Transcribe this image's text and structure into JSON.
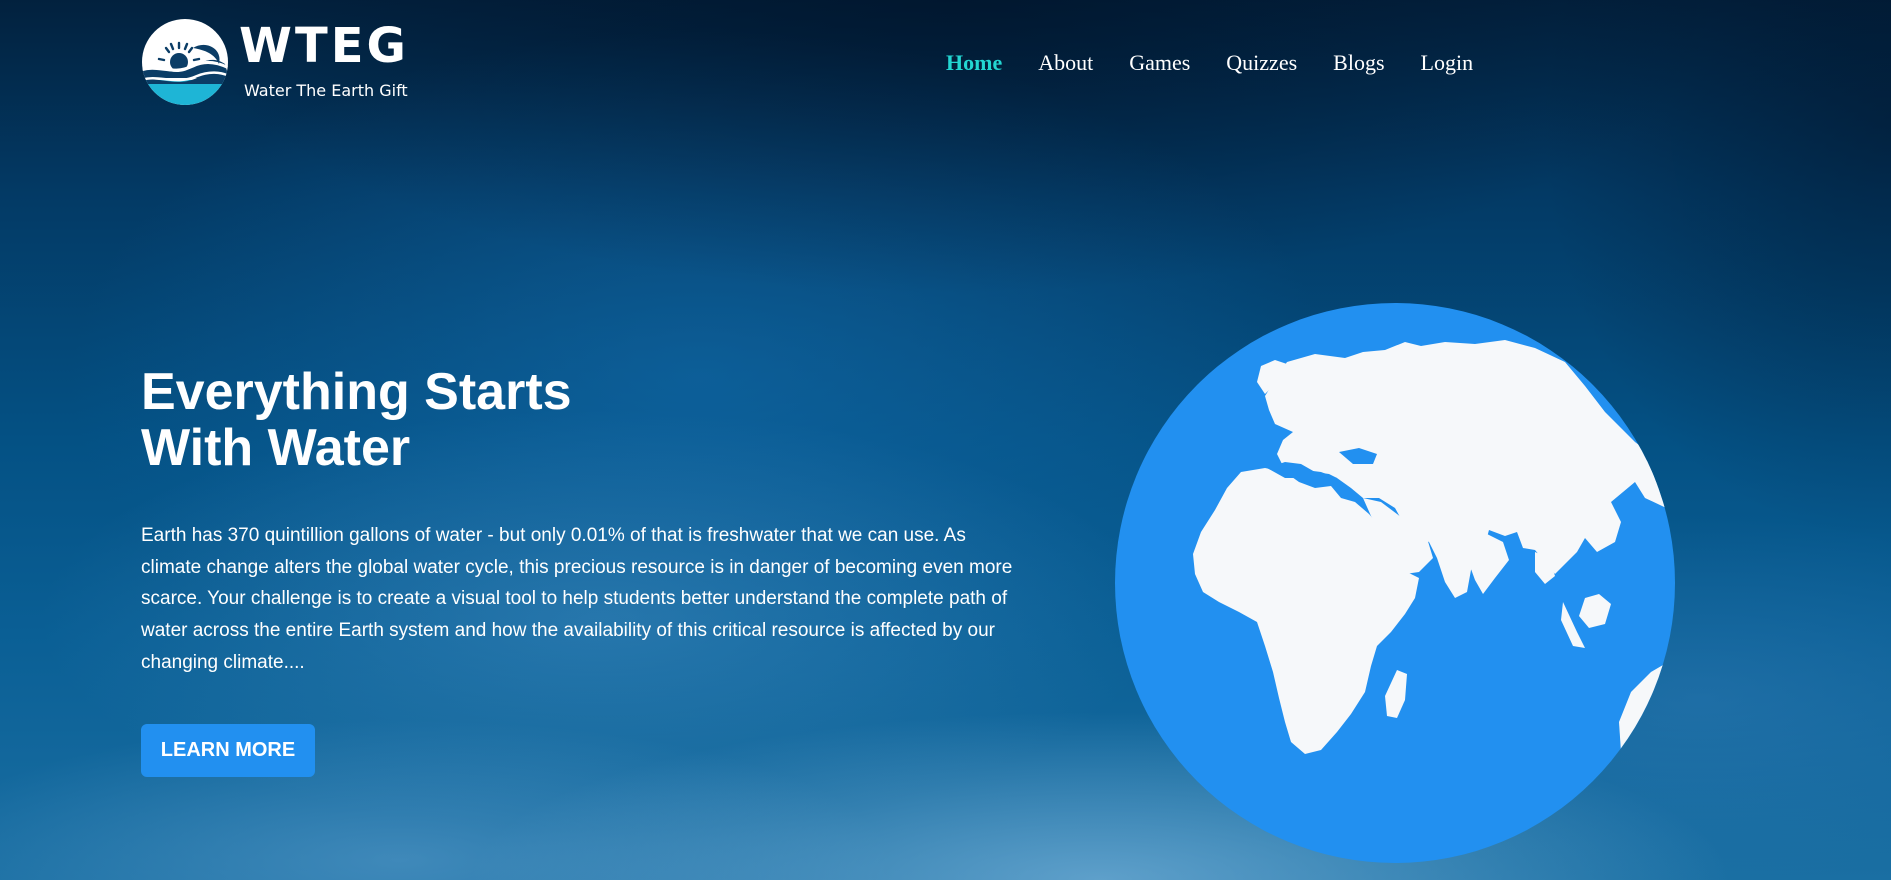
{
  "brand": {
    "name": "WTEG",
    "tagline": "Water The Earth Gift",
    "logo_icon": "sun-over-waves-logo"
  },
  "nav": {
    "items": [
      {
        "label": "Home",
        "active": true
      },
      {
        "label": "About",
        "active": false
      },
      {
        "label": "Games",
        "active": false
      },
      {
        "label": "Quizzes",
        "active": false
      },
      {
        "label": "Blogs",
        "active": false
      },
      {
        "label": "Login",
        "active": false
      }
    ]
  },
  "hero": {
    "headline_line1": "Everything Starts",
    "headline_line2": "With Water",
    "description": "Earth has 370 quintillion gallons of water - but only 0.01% of that is freshwater that we can use. As climate change alters the global water cycle, this precious resource is in danger of becoming even more scarce. Your challenge is to create a visual tool to help students better understand the complete path of water across the entire Earth system and how the availability of this critical resource is affected by our changing climate....",
    "cta_label": "LEARN MORE",
    "illustration_icon": "globe-icon"
  },
  "colors": {
    "accent": "#23d6d2",
    "button": "#2290f0",
    "globe_ocean": "#2290f0",
    "globe_land": "#f6f8fa",
    "logo_water": "#1eb5d6"
  }
}
